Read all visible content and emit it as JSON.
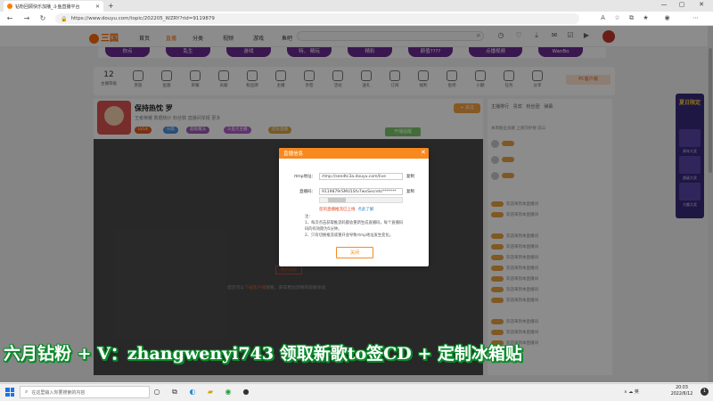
{
  "browser": {
    "tab_title": "钻粉回顾快乐加播_斗鱼直播平台",
    "url": "https://www.douyu.com/topic/202205_WZRY?rid=9119879",
    "new_tab": "+",
    "win_min": "—",
    "win_max": "▢",
    "win_close": "✕"
  },
  "header": {
    "logo": "三国",
    "nav": [
      "首页",
      "直播",
      "分类",
      "视频",
      "游戏",
      "鱼吧"
    ]
  },
  "categories": [
    "你点",
    "乱生",
    "游戏",
    "特、 精玩",
    "精彩",
    "颜值????",
    "点播视频",
    "WanBo"
  ],
  "icon_row": {
    "level": "12",
    "level_label": "主播等级",
    "items": [
      "贵族",
      "鱼翅",
      "荣耀",
      "贡献",
      "粉丝牌",
      "主播",
      "亲密",
      "活动",
      "送礼",
      "订阅",
      "福利",
      "鱼吧",
      "小额",
      "任务",
      "分享"
    ],
    "pc_client": "PC客户端"
  },
  "streamer": {
    "title": "保持热忱 罗",
    "meta": "王者荣耀  数据统计  粉丝数  直播间举报  更多",
    "id_tag": "LV14",
    "tags": [
      "分类",
      "超级魔法",
      "斗鱼大主播",
      "团队直播"
    ],
    "follow": "+ 关注",
    "green_btn": "开播提醒"
  },
  "video": {
    "hint_pre": "您还可以",
    "hint_link": "下载客户端",
    "hint_post": "观看，获得更加流畅的观看体验",
    "btn": "重新加载"
  },
  "right_panel": {
    "tabs": [
      "主播排行",
      "贵宾",
      "粉丝团",
      "弹幕"
    ],
    "intro": "本周粉丝贡献 上周守护榜 前三",
    "msgs": [
      "欢迎来到本直播间",
      "欢迎来到本直播间",
      "欢迎来到本直播间",
      "欢迎来到本直播间",
      "欢迎来到本直播间",
      "欢迎来到本直播间",
      "欢迎来到本直播间",
      "欢迎来到本直播间",
      "欢迎来到本直播间",
      "欢迎来到本直播间",
      "欢迎来到本直播间",
      "欢迎来到本直播间"
    ]
  },
  "promo": {
    "title": "夏日限定",
    "items": [
      "周年大奖",
      "超级大奖",
      "大额大奖"
    ]
  },
  "modal": {
    "title": "直播信息",
    "rtmp_label": "rtmp地址：",
    "rtmp_value": "rtmp://sendtc3a.douyu.com/live",
    "key_label": "直播码：",
    "key_value": "9119879rSMU1Sfv7wxSecrets*******",
    "copy": "复制",
    "warn": "您的直播推流已上线",
    "warn_link": "点此了解",
    "notes": [
      "注：",
      "1、每次点击获取推流码都会重新生成直播码，每个直播码",
      "    码的有效期为5分钟。",
      "2、只有切换推流或重开会导致rtmp地址发生变化。"
    ],
    "ok": "关闭"
  },
  "caption": "六月钻粉 + V：zhangwenyi743 领取新歌to签CD + 定制冰箱贴",
  "taskbar": {
    "search": "在这里输入你要搜索的内容",
    "tray": "∧  ☁  英",
    "time": "20:03",
    "date": "2022/6/12",
    "notif": "1"
  },
  "colors": {
    "accent": "#ff6a00",
    "modal_header": "#f7891f",
    "category_pill": "#6a2c91",
    "caption_outline": "#0a8a2a"
  }
}
